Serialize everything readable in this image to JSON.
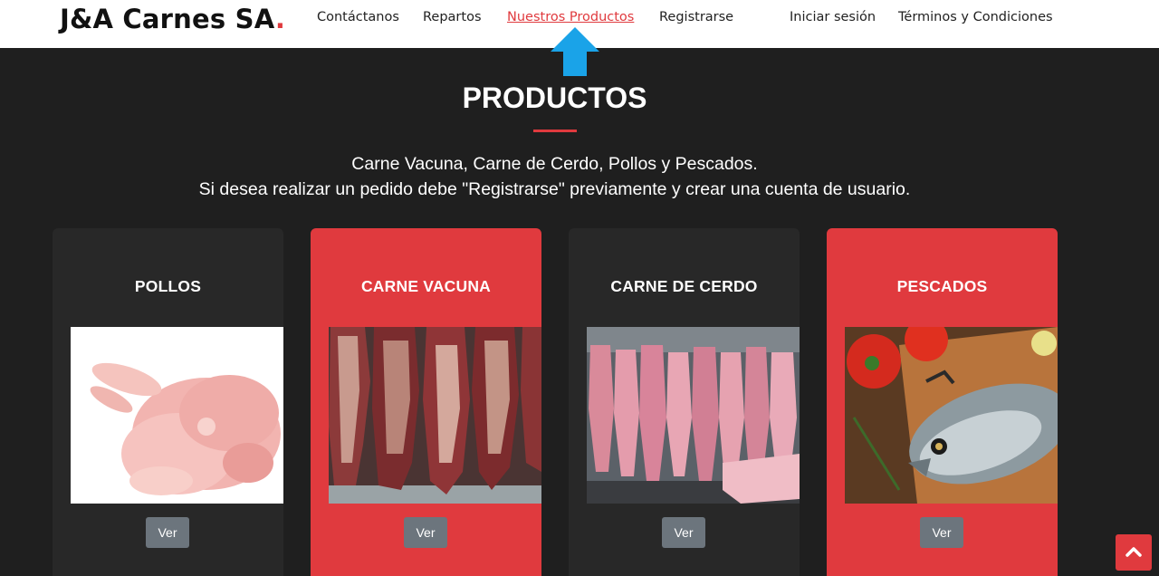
{
  "brand": {
    "name": "J&A Carnes SA",
    "dot": "."
  },
  "nav": [
    {
      "label": "Contáctanos",
      "active": false
    },
    {
      "label": "Repartos",
      "active": false
    },
    {
      "label": "Nuestros Productos",
      "active": true
    },
    {
      "label": "Registrarse",
      "active": false
    },
    {
      "label": "Iniciar sesión",
      "active": false
    },
    {
      "label": "Términos y Condiciones",
      "active": false
    }
  ],
  "section": {
    "title": "PRODUCTOS",
    "line1": "Carne Vacuna, Carne de Cerdo, Pollos y Pescados.",
    "line2": "Si desea realizar un pedido debe \"Registrarse\" previamente y crear una cuenta de usuario."
  },
  "products": [
    {
      "title": "POLLOS",
      "button": "Ver",
      "image": "raw-chicken-photo"
    },
    {
      "title": "CARNE VACUNA",
      "button": "Ver",
      "image": "hanging-beef-photo"
    },
    {
      "title": "CARNE DE CERDO",
      "button": "Ver",
      "image": "hanging-pork-photo"
    },
    {
      "title": "PESCADOS",
      "button": "Ver",
      "image": "fish-tomatoes-photo"
    }
  ],
  "icons": {
    "annotation": "blue-up-arrow",
    "scroll_top": "chevron-up-icon"
  },
  "colors": {
    "accent": "#e03a3e",
    "dark": "#1f1f1f",
    "card_dark": "#282828",
    "button": "#6c757d",
    "arrow": "#1aa3e8"
  }
}
